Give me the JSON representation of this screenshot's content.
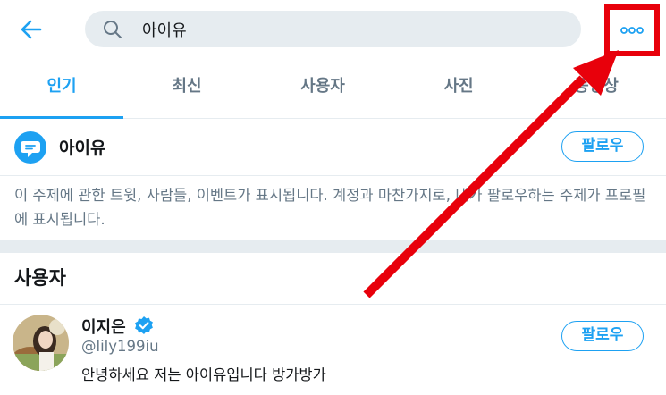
{
  "search": {
    "value": "아이유"
  },
  "tabs": [
    {
      "label": "인기",
      "active": true
    },
    {
      "label": "최신",
      "active": false
    },
    {
      "label": "사용자",
      "active": false
    },
    {
      "label": "사진",
      "active": false
    },
    {
      "label": "동영상",
      "active": false
    }
  ],
  "topic": {
    "name": "아이유",
    "follow_label": "팔로우",
    "description": "이 주제에 관한 트윗, 사람들, 이벤트가 표시됩니다. 계정과 마찬가지로, 내가 팔로우하는 주제가 프로필에 표시됩니다."
  },
  "users_section": {
    "title": "사용자",
    "users": [
      {
        "name": "이지은",
        "handle": "@lily199iu",
        "bio": "안녕하세요 저는 아이유입니다 방가방가",
        "verified": true,
        "follow_label": "팔로우"
      }
    ]
  },
  "colors": {
    "accent": "#1da1f2",
    "highlight": "#e8000b",
    "muted": "#657786",
    "search_bg": "#e6ecf0"
  },
  "icons": {
    "back": "arrow-left-icon",
    "search": "magnifier-icon",
    "more": "more-dots-icon",
    "topic": "speech-bubble-icon",
    "verified": "verified-badge-icon"
  }
}
